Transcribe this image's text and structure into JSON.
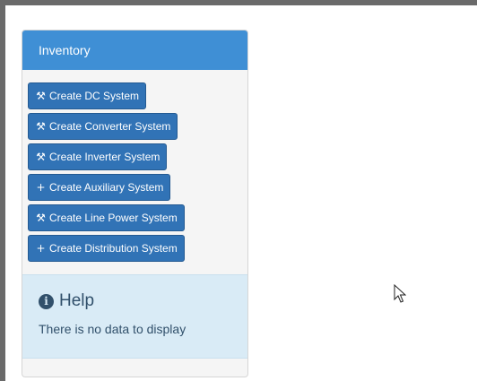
{
  "inventory": {
    "title": "Inventory",
    "buttons": [
      {
        "label": "Create DC System",
        "icon": "wrench-icon",
        "glyph": "⚒"
      },
      {
        "label": "Create Converter System",
        "icon": "wrench-icon",
        "glyph": "⚒"
      },
      {
        "label": "Create Inverter System",
        "icon": "wrench-icon",
        "glyph": "⚒"
      },
      {
        "label": "Create Auxiliary System",
        "icon": "plus-icon",
        "glyph": "+"
      },
      {
        "label": "Create Line Power System",
        "icon": "wrench-icon",
        "glyph": "⚒"
      },
      {
        "label": "Create Distribution System",
        "icon": "plus-icon",
        "glyph": "+"
      }
    ]
  },
  "help": {
    "title": "Help",
    "message": "There is no data to display",
    "icon": "info-circle-icon"
  },
  "colors": {
    "heading_bg": "#3f8fd5",
    "button_bg": "#3173b6",
    "help_bg": "#d9ebf6"
  }
}
